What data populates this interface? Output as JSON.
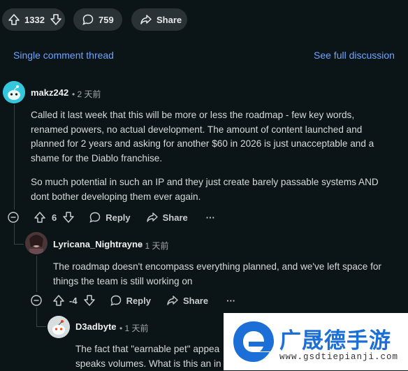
{
  "post_bar": {
    "upvote_count": "1332",
    "comment_count": "759",
    "share_label": "Share"
  },
  "thread_nav": {
    "single_thread": "Single comment thread",
    "full_discussion": "See full discussion"
  },
  "comments": [
    {
      "username": "makz242",
      "time": "• 2 天前",
      "paragraphs": [
        "Called it last week that this will be more or less the roadmap - few key words, renamed powers, no actual development. The amount of content launched and planned for 2 years and asking for another $60 in 2026 is just unacceptable and a shame for the Diablo franchise.",
        "So much potential in such an IP and they just create barely passable systems AND dont bother developing them ever again."
      ],
      "score": "6",
      "reply_label": "Reply",
      "share_label": "Share",
      "more_label": "···"
    },
    {
      "username": "Lyricana_Nightrayne",
      "time": "• 1 天前",
      "paragraphs": [
        "The roadmap doesn't encompass everything planned, and we've left space for things the team is still working on"
      ],
      "score": "-4",
      "reply_label": "Reply",
      "share_label": "Share",
      "more_label": "···"
    },
    {
      "username": "D3adbyte",
      "time": "• 1 天前",
      "paragraphs": [
        "The fact that \"earnable pet\" appea",
        "speaks volumes. What is this an in"
      ]
    }
  ],
  "watermark": {
    "brand": "广晟德手游",
    "url": "www.gsdtiepianji.com"
  },
  "colors": {
    "background": "#0b1416",
    "link": "#6fa5ff",
    "pill": "#2a3236"
  }
}
